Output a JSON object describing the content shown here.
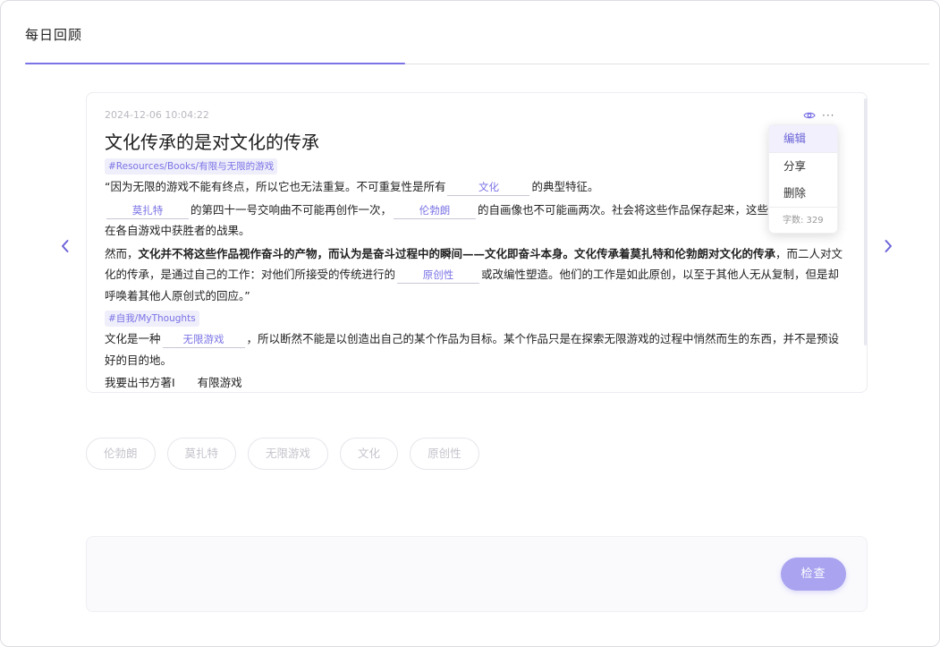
{
  "app": {
    "title": "每日回顾",
    "progress": 0.42
  },
  "colors": {
    "accent": "#7b73e6",
    "tag_bg": "#efeefb",
    "button": "#a9a3f0"
  },
  "nav": {
    "prev_icon": "chevron-left-icon",
    "next_icon": "chevron-right-icon"
  },
  "card": {
    "timestamp": "2024-12-06 10:04:22",
    "title": "文化传承的是对文化的传承",
    "tag1": "#Resources/Books/有限与无限的游戏",
    "p1": {
      "a": "“因为无限的游戏不能有终点，所以它也无法重复。不可重复性是所有",
      "blank1": "文化",
      "b": "的典型特征。"
    },
    "p2": {
      "blank1": "莫扎特",
      "a": "的第四十一号交响曲不可能再创作一次，",
      "blank2": "伦勃朗",
      "b": "的自画像也不可能画两次。社会将这些作品保存起来，这些作品也",
      "c": "在各自游戏中获胜者的战果。"
    },
    "p3": {
      "a": "然而，",
      "bold": "文化并不将这些作品视作奋斗的产物，而认为是奋斗过程中的瞬间——文化即奋斗本身。文化传承着莫扎特和伦勃朗对文化的传承",
      "b": "，而二人对文化的传承，是通过自己的工作：对他们所接受的传统进行的",
      "blank1": "原创性",
      "c": "或改编性塑造。他们的工作是如此原创，以至于其他人无从复制，但是却呼唤着其他人原创式的回应。”"
    },
    "tag2": "#自我/MyThoughts",
    "p4": {
      "a": "文化是一种",
      "blank1": "无限游戏",
      "b": "，所以断然不能是以创造出自己的某个作品为目标。某个作品只是在探索无限游戏的过程中悄然而生的东西，并不是预设好的目的地。"
    },
    "p5": {
      "a": "我要出书方著I　　有限游戏"
    }
  },
  "menu": {
    "items": [
      "编辑",
      "分享",
      "删除"
    ],
    "word_count": "字数: 329"
  },
  "chips": [
    "伦勃朗",
    "莫扎特",
    "无限游戏",
    "文化",
    "原创性"
  ],
  "check_button": "检查"
}
